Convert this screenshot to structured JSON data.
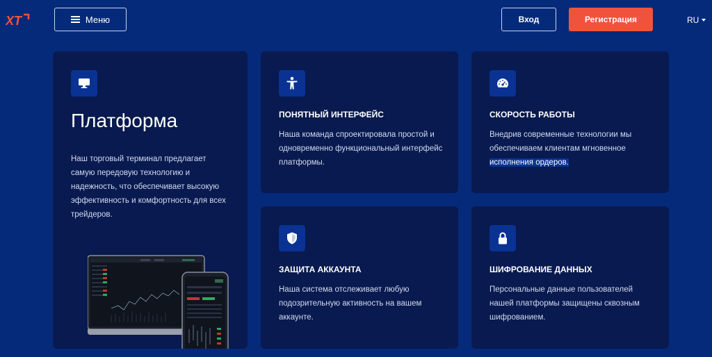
{
  "header": {
    "logo_text": "XT",
    "menu_label": "Меню",
    "login_label": "Вход",
    "register_label": "Регистрация",
    "language": "RU"
  },
  "colors": {
    "background": "#062a7a",
    "card": "#081a4f",
    "icon_bg": "#0a3293",
    "accent": "#f0533c"
  },
  "platform": {
    "icon": "monitor-icon",
    "title": "Платформа",
    "description_lines": [
      "Наш торговый терминал предлагает",
      "самую передовую технологию и",
      "надежность, что обеспечивает высокую",
      "эффективность и комфортность для всех",
      "трейдеров."
    ]
  },
  "features": [
    {
      "icon": "accessibility-icon",
      "title": "ПОНЯТНЫЙ ИНТЕРФЕЙС",
      "lines": [
        "Наша команда спроектировала простой и",
        "одновременно функциональный интерфейс",
        "платформы."
      ]
    },
    {
      "icon": "speedometer-icon",
      "title": "СКОРОСТЬ РАБОТЫ",
      "lines": [
        "Внедрив современные технологии мы",
        "обеспечиваем клиентам мгновенное",
        "исполнения ордеров."
      ]
    },
    {
      "icon": "shield-icon",
      "title": "ЗАЩИТА АККАУНТА",
      "lines": [
        "Наша система отслеживает любую",
        "подозрительную активность на вашем",
        "аккаунте."
      ]
    },
    {
      "icon": "lock-icon",
      "title": "ШИФРОВАНИЕ ДАННЫХ",
      "lines": [
        "Персональные данные пользователей",
        "нашей платформы защищены сквозным",
        "шифрованием."
      ]
    }
  ]
}
